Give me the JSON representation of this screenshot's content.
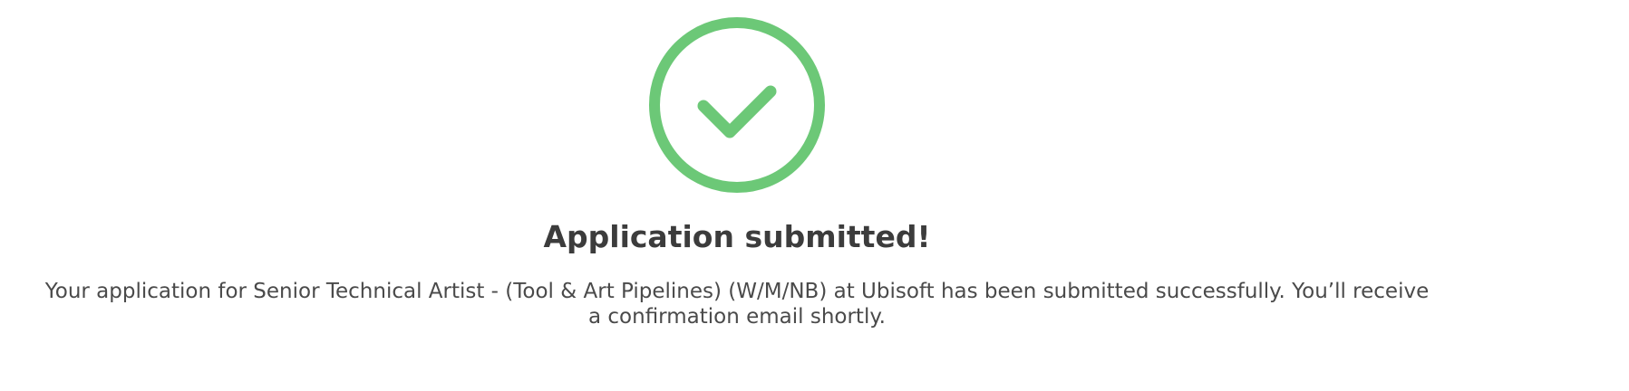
{
  "confirmation": {
    "icon": "check-circle-icon",
    "icon_color": "#6cc877",
    "title": "Application submitted!",
    "message": "Your application for Senior Technical Artist - (Tool & Art Pipelines) (W/M/NB) at Ubisoft has been submitted successfully. You’ll receive a confirmation email shortly."
  }
}
